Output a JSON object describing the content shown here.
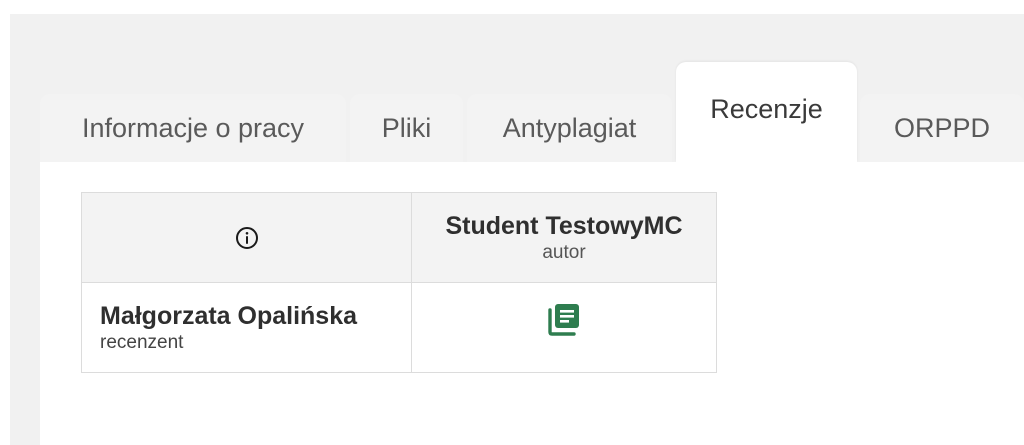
{
  "tabs": [
    {
      "label": "Informacje o pracy",
      "active": false
    },
    {
      "label": "Pliki",
      "active": false
    },
    {
      "label": "Antyplagiat",
      "active": false
    },
    {
      "label": "Recenzje",
      "active": true
    },
    {
      "label": "ORPPD",
      "active": false
    }
  ],
  "reviews_table": {
    "header_icon": "info-circle-icon",
    "author": {
      "name": "Student TestowyMC",
      "role": "autor"
    },
    "reviewers": [
      {
        "name": "Małgorzata Opalińska",
        "role": "recenzent",
        "review_icon": "review-document-icon",
        "review_icon_color": "#2e7d4f"
      }
    ]
  },
  "colors": {
    "background": "#f1f1f1",
    "tab_inactive": "#f3f3f3",
    "tab_active": "#ffffff",
    "accent_green": "#2e7d4f"
  }
}
